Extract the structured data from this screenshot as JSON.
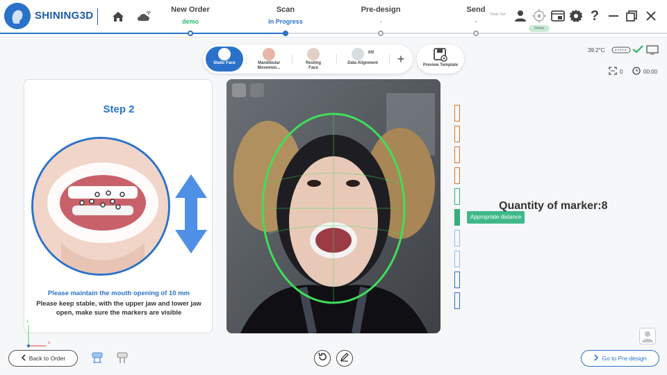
{
  "app": {
    "name": "SHINING3D",
    "user": "Rudy Yan",
    "status_chip": "Online"
  },
  "steps": [
    {
      "title": "New Order",
      "status": "demo"
    },
    {
      "title": "Scan",
      "status": "In Progress"
    },
    {
      "title": "Pre-design",
      "status": "-"
    },
    {
      "title": "Send",
      "status": "-"
    }
  ],
  "modes": [
    {
      "label": "Static Face",
      "active": true
    },
    {
      "label": "Mandibular Movemen...",
      "active": false
    },
    {
      "label": "Resting Face",
      "active": false
    },
    {
      "label": "Data Alignment",
      "count": "0/0",
      "active": false
    }
  ],
  "preview_template": "Preview Template",
  "status": {
    "temperature": "39.2°C",
    "marker_count": "0",
    "timer": "00:00"
  },
  "guide": {
    "step_title": "Step 2",
    "instruction_primary": "Please maintain the mouth opening of 10 mm",
    "instruction_secondary": "Please keep stable, with the upper jaw and lower jaw open, make sure the markers are visible"
  },
  "distance": {
    "tooltip": "Appropriate distance",
    "marker_quantity": "Quantity of marker:8"
  },
  "buttons": {
    "back": "Back to Order",
    "next": "Go to Pre-design"
  },
  "axis": {
    "x": "x",
    "y": "y"
  },
  "colors": {
    "brand": "#2a72c9",
    "success": "#2fb36a",
    "face_guide": "#3ee05a",
    "warning": "#d9742d"
  }
}
